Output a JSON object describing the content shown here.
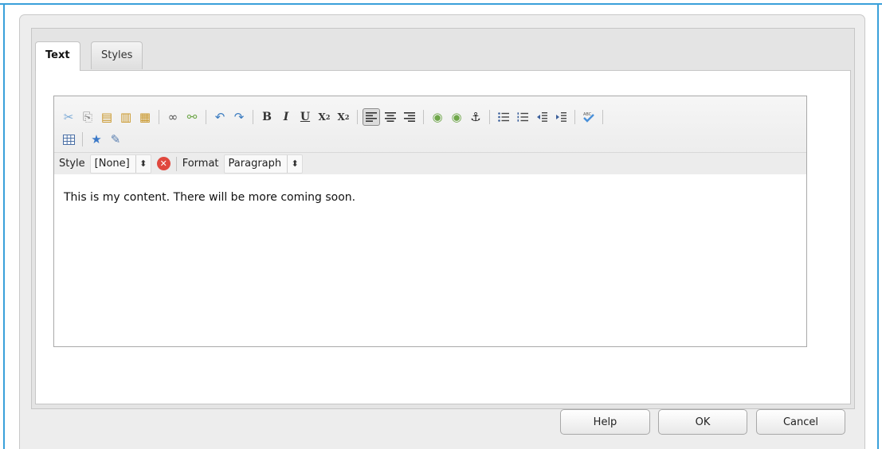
{
  "tabs": [
    {
      "label": "Text",
      "active": true
    },
    {
      "label": "Styles",
      "active": false
    }
  ],
  "toolbar": {
    "row1": [
      {
        "icon": "cut-icon",
        "glyph": "✂"
      },
      {
        "icon": "copy-icon",
        "glyph": "⎘"
      },
      {
        "icon": "paste-icon",
        "glyph": "📋"
      },
      {
        "icon": "paste-text-icon",
        "glyph": "📋"
      },
      {
        "icon": "paste-word-icon",
        "glyph": "📋"
      },
      {
        "icon": "link-icon",
        "glyph": "🔗"
      },
      {
        "icon": "unlink-icon",
        "glyph": "⛓"
      },
      {
        "icon": "undo-icon",
        "glyph": "↶"
      },
      {
        "icon": "redo-icon",
        "glyph": "↷"
      },
      {
        "icon": "bold-icon",
        "glyph": "B"
      },
      {
        "icon": "italic-icon",
        "glyph": "I"
      },
      {
        "icon": "underline-icon",
        "glyph": "U"
      },
      {
        "icon": "subscript-icon",
        "glyph": "X₂"
      },
      {
        "icon": "superscript-icon",
        "glyph": "X²"
      },
      {
        "icon": "align-left-icon",
        "glyph": "☰"
      },
      {
        "icon": "align-center-icon",
        "glyph": "☰"
      },
      {
        "icon": "align-right-icon",
        "glyph": "☰"
      },
      {
        "icon": "image-icon",
        "glyph": "◉"
      },
      {
        "icon": "image-link-icon",
        "glyph": "◉"
      },
      {
        "icon": "anchor-icon",
        "glyph": "⚓"
      },
      {
        "icon": "bulleted-list-icon",
        "glyph": "☷"
      },
      {
        "icon": "numbered-list-icon",
        "glyph": "☷"
      },
      {
        "icon": "outdent-icon",
        "glyph": "⇤"
      },
      {
        "icon": "indent-icon",
        "glyph": "⇥"
      },
      {
        "icon": "spellcheck-icon",
        "glyph": "✔"
      }
    ],
    "row2": [
      {
        "icon": "table-icon",
        "glyph": "▦"
      },
      {
        "icon": "special-character-icon",
        "glyph": "★"
      },
      {
        "icon": "edit-source-icon",
        "glyph": "✎"
      }
    ]
  },
  "stylebar": {
    "style_label": "Style",
    "style_value": "[None]",
    "format_label": "Format",
    "format_value": "Paragraph"
  },
  "content": {
    "text": "This is my content. There will be more coming soon."
  },
  "footer": {
    "help_label": "Help",
    "ok_label": "OK",
    "cancel_label": "Cancel"
  },
  "colors": {
    "accent_frame": "#3aa0da",
    "clear_button": "#e0483e"
  }
}
